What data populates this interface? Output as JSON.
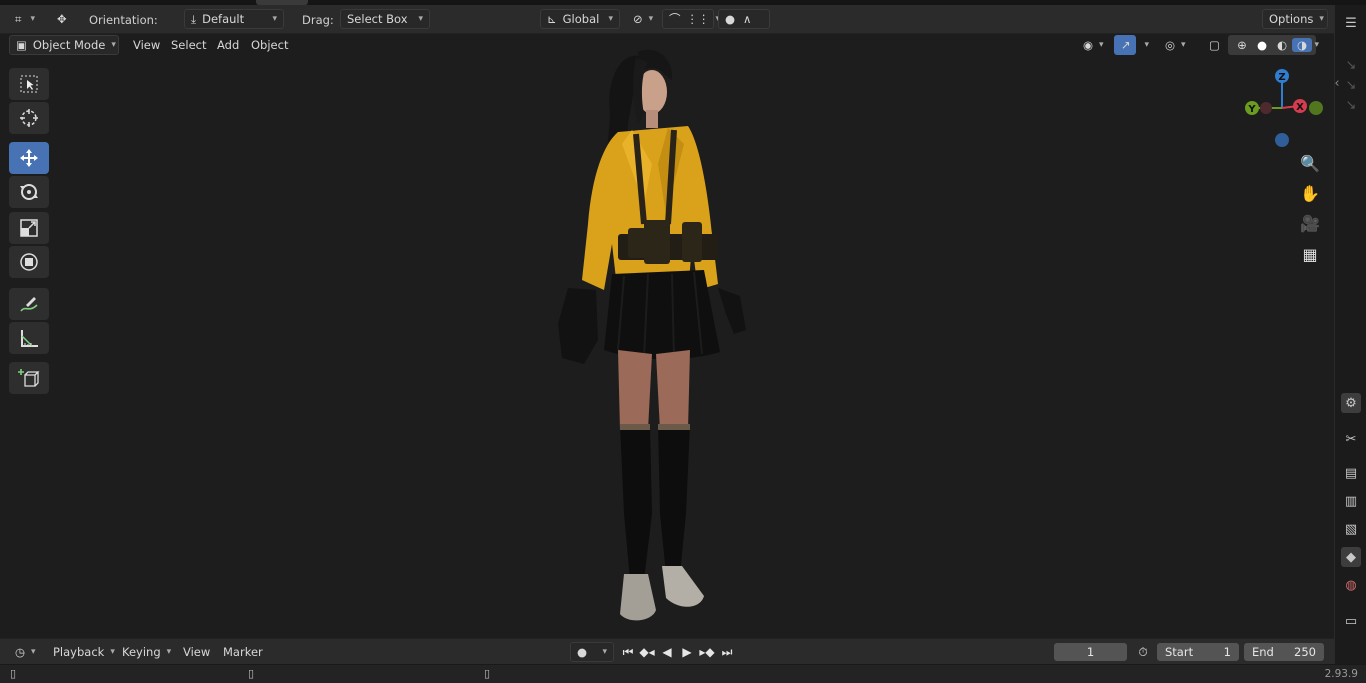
{
  "header": {
    "orientation_label": "Orientation:",
    "orientation_value": "Default",
    "drag_label": "Drag:",
    "drag_value": "Select Box",
    "transform_space": "Global",
    "options_label": "Options"
  },
  "viewport_header": {
    "mode": "Object Mode",
    "menus": [
      "View",
      "Select",
      "Add",
      "Object"
    ]
  },
  "toolbar": {
    "tools": [
      {
        "name": "select-box-tool",
        "icon": "select-box-icon"
      },
      {
        "name": "cursor-tool",
        "icon": "cursor-icon"
      },
      {
        "name": "move-tool",
        "icon": "move-icon",
        "active": true
      },
      {
        "name": "rotate-tool",
        "icon": "rotate-icon"
      },
      {
        "name": "scale-tool",
        "icon": "scale-icon"
      },
      {
        "name": "transform-tool",
        "icon": "transform-icon"
      },
      {
        "name": "annotate-tool",
        "icon": "annotate-icon"
      },
      {
        "name": "measure-tool",
        "icon": "measure-icon"
      },
      {
        "name": "add-cube-tool",
        "icon": "add-cube-icon"
      }
    ]
  },
  "gizmo": {
    "axes": {
      "x": "X",
      "y": "Y",
      "z": "Z"
    },
    "colors": {
      "x": "#d63c4f",
      "y": "#6a9d1f",
      "z": "#2f7ed1",
      "accent": "#4772b3"
    }
  },
  "timeline": {
    "menus": [
      "Playback",
      "Keying",
      "View",
      "Marker"
    ],
    "current_frame": "1",
    "start_label": "Start",
    "start_value": "1",
    "end_label": "End",
    "end_value": "250"
  },
  "status": {
    "version": "2.93.9"
  }
}
